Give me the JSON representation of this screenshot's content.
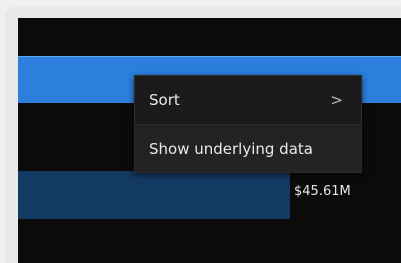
{
  "context_menu": {
    "items": [
      {
        "label": "Sort",
        "has_submenu": true
      },
      {
        "label": "Show underlying data",
        "has_submenu": false
      }
    ],
    "submenu_glyph": ">"
  },
  "chart": {
    "bar_value_label": "$45.61M"
  },
  "colors": {
    "selection": "#2c7fdc",
    "bar": "#133a62",
    "menu_bg": "#1b1b1b",
    "canvas_bg": "#0b0b0b"
  }
}
